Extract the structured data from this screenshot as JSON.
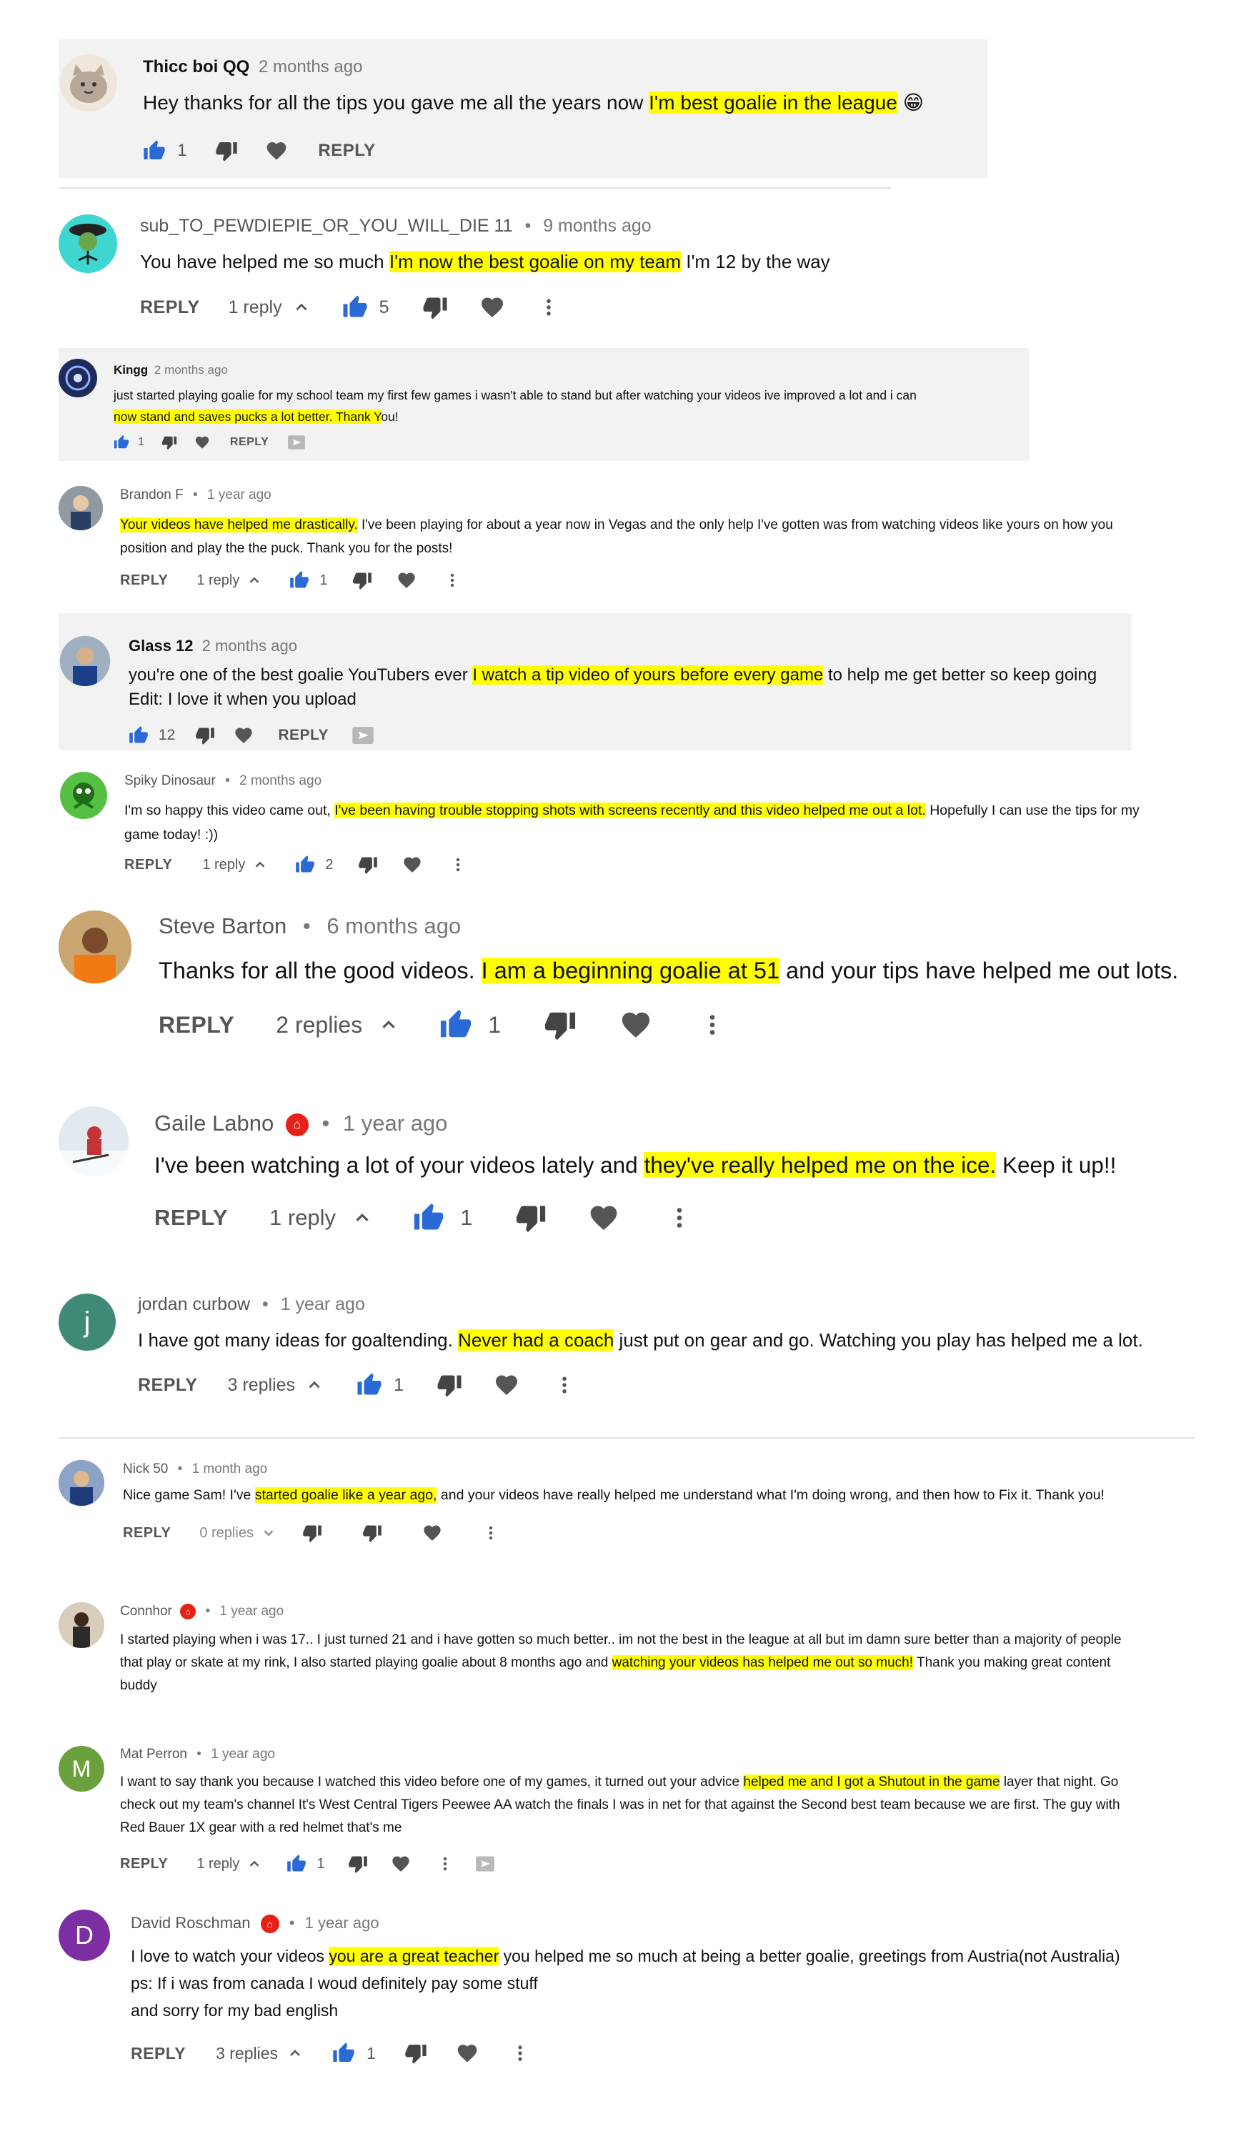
{
  "labels": {
    "reply": "REPLY",
    "dot": "•"
  },
  "comments": [
    {
      "author": "Thicc boi QQ",
      "time": "2 months ago",
      "pre": "Hey thanks for all the tips you gave me all the years now ",
      "hl": "I'm best goalie in the league",
      "post": " 😁",
      "likes": "1"
    },
    {
      "author": "sub_TO_PEWDIEPIE_OR_YOU_WILL_DIE 11",
      "time": "9 months ago",
      "pre": "You have helped me so much ",
      "hl": "I'm now the best goalie on my team",
      "post": " I'm 12 by the way",
      "replies": "1 reply",
      "likes": "5"
    },
    {
      "author": "Kingg",
      "time": "2 months ago",
      "line1": "just started playing goalie for my school team my first few games i wasn't able to stand but after watching your videos ive improved a lot and i can",
      "hl": "now stand and saves pucks a lot better. Thank Y",
      "post": "ou!",
      "likes": "1"
    },
    {
      "author": "Brandon F",
      "time": "1 year ago",
      "hl": "Your videos have helped me drastically.",
      "post": " I've been playing for about a year now in Vegas and the only help I've gotten was from watching videos like yours on how you",
      "line2": "position and play the the puck. Thank you for the posts!",
      "replies": "1 reply",
      "likes": "1"
    },
    {
      "author": "Glass 12",
      "time": "2 months ago",
      "pre": "you're one of the best goalie YouTubers ever ",
      "hl": "I watch a tip video of yours before every game",
      "post": " to help me get better so keep going",
      "line2": "Edit: I love it when you upload",
      "likes": "12"
    },
    {
      "author": "Spiky Dinosaur",
      "time": "2 months ago",
      "pre": "I'm so happy this video came out, ",
      "hl": "I've been having trouble stopping shots with screens recently and this video helped me out a lot.",
      "post": " Hopefully I can use the tips for my",
      "line2": "game today! :))",
      "replies": "1 reply",
      "likes": "2"
    },
    {
      "author": "Steve Barton",
      "time": "6 months ago",
      "pre": "Thanks for all the good videos. ",
      "hl": "I am a beginning goalie at 51",
      "post": " and your tips have helped me out lots.",
      "replies": "2 replies",
      "likes": "1"
    },
    {
      "author": "Gaile Labno",
      "time": "1 year ago",
      "pre": "I've been watching a lot of your videos lately and ",
      "hl": "they've really helped me on the ice.",
      "post": " Keep it up!!",
      "replies": "1 reply",
      "likes": "1"
    },
    {
      "author": "jordan curbow",
      "time": "1 year ago",
      "avatar_letter": "j",
      "pre": "I have got many ideas for goaltending. ",
      "hl": "Never had a coach",
      "post": " just put on gear and go. Watching you play has helped me a lot.",
      "replies": "3 replies",
      "likes": "1"
    },
    {
      "author": "Nick 50",
      "time": "1 month ago",
      "pre": "Nice game Sam! I've ",
      "hl": "started goalie like a year ago,",
      "post": " and your videos have really helped me understand what I'm doing wrong, and then how to Fix it. Thank you!",
      "replies": "0 replies"
    },
    {
      "author": "Connhor",
      "time": "1 year ago",
      "line1": "I started playing when i was 17.. I just turned 21 and i have gotten so much better.. im not the best in the league at all but im damn sure better than a majority of people",
      "pre": "that play or skate at my rink, I also started playing goalie about 8 months ago and ",
      "hl": "watching your videos has helped me out so much!",
      "post": " Thank you making great content",
      "line3": "buddy"
    },
    {
      "author": "Mat Perron",
      "time": "1 year ago",
      "avatar_letter": "M",
      "pre": "I want to say thank you because I watched this video before one of my games, it turned out your advice ",
      "hl": "helped me and I got a Shutout in the game",
      "post": " layer that night. Go",
      "line2": "check out my team's channel It's West Central Tigers Peewee AA watch the finals I was in net for that against the Second best team because we are first. The guy with",
      "line3": "Red Bauer 1X gear with a red helmet that's me",
      "replies": "1 reply",
      "likes": "1"
    },
    {
      "author": "David Roschman",
      "time": "1 year ago",
      "avatar_letter": "D",
      "pre": "I love to watch your videos ",
      "hl": "you are a great teacher",
      "post": " you helped me so much at being a better goalie, greetings from Austria(not Australia)",
      "line2": "ps: If i was from canada I woud definitely pay some stuff",
      "line3": "and sorry for my bad english",
      "replies": "3 replies",
      "likes": "1"
    }
  ]
}
